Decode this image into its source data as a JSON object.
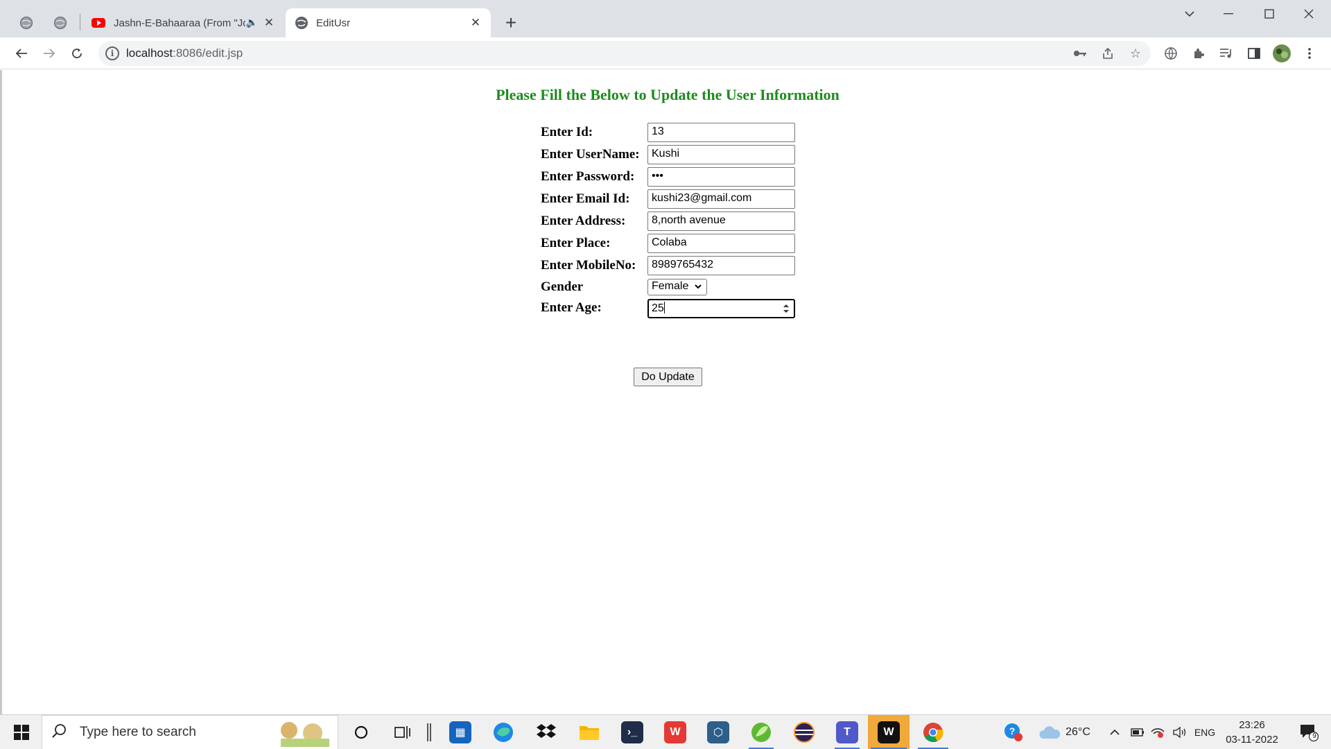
{
  "browser": {
    "tabs": [
      {
        "title": "Jashn-E-Bahaaraa (From \"Joc",
        "icon": "youtube-icon",
        "audio": "speaker-icon"
      },
      {
        "title": "EditUsr",
        "icon": "globe-icon"
      }
    ],
    "url_host": "localhost",
    "url_path": ":8086/edit.jsp"
  },
  "page": {
    "heading": "Please Fill the Below to Update the User Information",
    "form": {
      "id_label": "Enter Id:",
      "id_value": "13",
      "username_label": "Enter UserName:",
      "username_value": "Kushi",
      "password_label": "Enter Password:",
      "password_value": "•••",
      "email_label": "Enter Email Id:",
      "email_value": "kushi23@gmail.com",
      "address_label": "Enter Address:",
      "address_value": "8,north avenue",
      "place_label": "Enter Place:",
      "place_value": "Colaba",
      "mobile_label": "Enter MobileNo:",
      "mobile_value": "8989765432",
      "gender_label": "Gender",
      "gender_value": "Female",
      "age_label": "Enter Age:",
      "age_value": "25",
      "submit_label": "Do Update"
    }
  },
  "taskbar": {
    "search_placeholder": "Type here to search",
    "weather": "26°C",
    "language": "ENG",
    "time": "23:26",
    "date": "03-11-2022",
    "notification_count": "9"
  },
  "colors": {
    "heading": "#1f8b1f",
    "tabstrip": "#dee1e6",
    "taskbar": "#f0f0f0"
  }
}
